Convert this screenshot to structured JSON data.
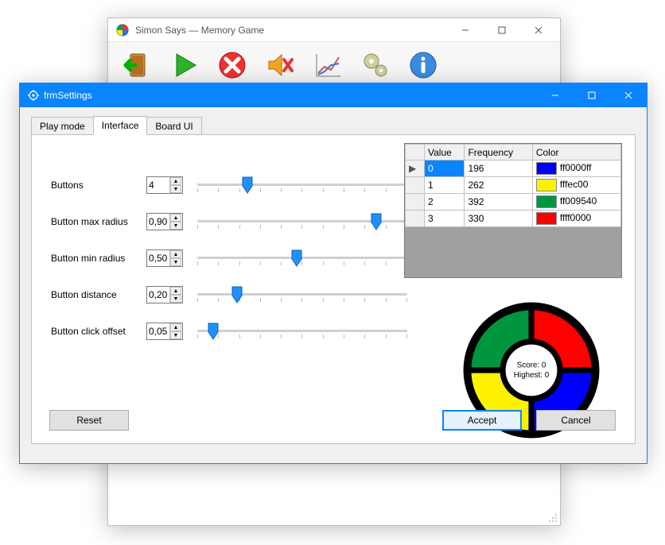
{
  "parent_window": {
    "title": "Simon Says — Memory Game",
    "toolbar_icons": [
      "exit-icon",
      "play-icon",
      "stop-icon",
      "mute-icon",
      "stats-icon",
      "settings-icon",
      "about-icon"
    ]
  },
  "settings_window": {
    "title": "frmSettings",
    "tabs": {
      "playmode": "Play mode",
      "interface": "Interface",
      "boardui": "Board UI"
    },
    "active_tab": "interface",
    "sliders": {
      "buttons": {
        "label": "Buttons",
        "value": "4",
        "pos": 0.25
      },
      "max_radius": {
        "label": "Button max radius",
        "value": "0,90",
        "pos": 0.9
      },
      "min_radius": {
        "label": "Button min radius",
        "value": "0,50",
        "pos": 0.5
      },
      "distance": {
        "label": "Button distance",
        "value": "0,20",
        "pos": 0.2
      },
      "click_offset": {
        "label": "Button click offset",
        "value": "0,05",
        "pos": 0.08
      }
    },
    "grid": {
      "headers": {
        "value": "Value",
        "frequency": "Frequency",
        "color": "Color"
      },
      "rows": [
        {
          "value": "0",
          "freq": "196",
          "hex": "ff0000ff",
          "swatch": "#0000ff"
        },
        {
          "value": "1",
          "freq": "262",
          "hex": "fffec00",
          "swatch": "#fff200"
        },
        {
          "value": "2",
          "freq": "392",
          "hex": "ff009540",
          "swatch": "#009640"
        },
        {
          "value": "3",
          "freq": "330",
          "hex": "ffff0000",
          "swatch": "#ff0000"
        }
      ]
    },
    "preview": {
      "score_label": "Score: 0",
      "highest_label": "Highest: 0"
    },
    "buttons": {
      "reset": "Reset",
      "accept": "Accept",
      "cancel": "Cancel"
    }
  }
}
